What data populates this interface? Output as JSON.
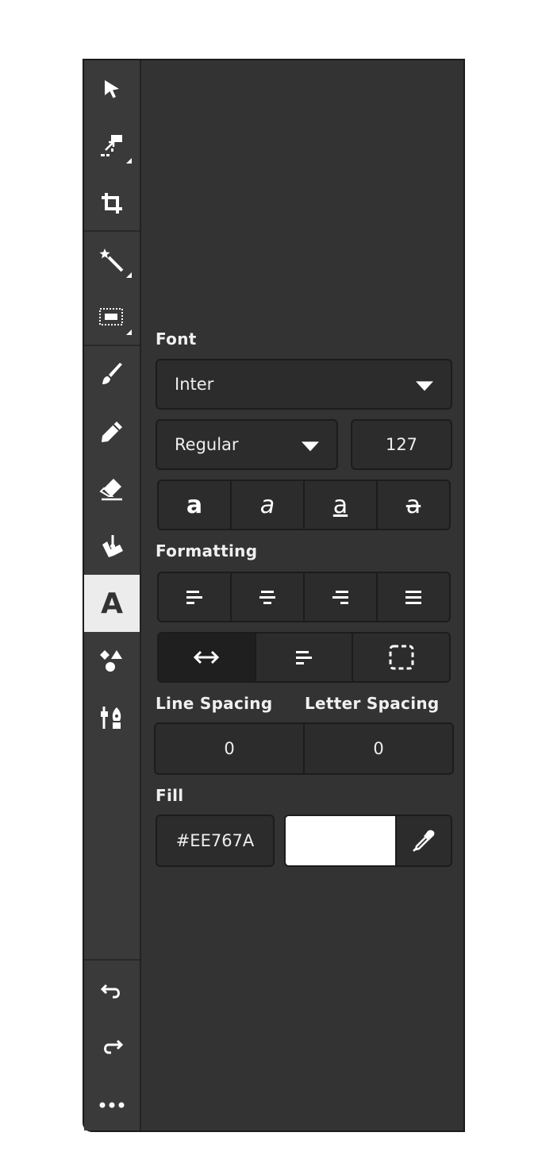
{
  "toolbar": {
    "tools": [
      {
        "icon": "cursor-icon"
      },
      {
        "icon": "transform-icon"
      },
      {
        "icon": "crop-icon"
      },
      {
        "icon": "magic-wand-icon"
      },
      {
        "icon": "selection-icon"
      },
      {
        "icon": "brush-icon"
      },
      {
        "icon": "pencil-icon"
      },
      {
        "icon": "eraser-icon"
      },
      {
        "icon": "fill-bucket-icon"
      },
      {
        "icon": "text-tool-icon",
        "glyph": "A",
        "active": true
      },
      {
        "icon": "shapes-icon"
      },
      {
        "icon": "adjust-icon"
      }
    ],
    "bottom": [
      {
        "icon": "undo-icon"
      },
      {
        "icon": "redo-icon"
      },
      {
        "icon": "more-icon"
      }
    ]
  },
  "font": {
    "label": "Font",
    "family": "Inter",
    "weight": "Regular",
    "size": "127",
    "styles": [
      {
        "icon": "bold-icon",
        "glyph": "a"
      },
      {
        "icon": "italic-icon",
        "glyph": "a"
      },
      {
        "icon": "underline-icon",
        "glyph": "a"
      },
      {
        "icon": "strikethrough-icon",
        "glyph": "a"
      }
    ]
  },
  "formatting": {
    "label": "Formatting",
    "align": [
      "align-left-icon",
      "align-center-icon",
      "align-right-icon",
      "align-justify-icon"
    ],
    "wrap": [
      {
        "icon": "auto-width-icon",
        "active": true
      },
      {
        "icon": "auto-height-icon",
        "active": false
      },
      {
        "icon": "fixed-size-icon",
        "active": false
      }
    ]
  },
  "spacing": {
    "line_label": "Line Spacing",
    "letter_label": "Letter Spacing",
    "line_value": "0",
    "letter_value": "0"
  },
  "fill": {
    "label": "Fill",
    "hex": "#EE767A",
    "swatch_color": "#ffffff",
    "picker_icon": "eyedropper-icon"
  }
}
